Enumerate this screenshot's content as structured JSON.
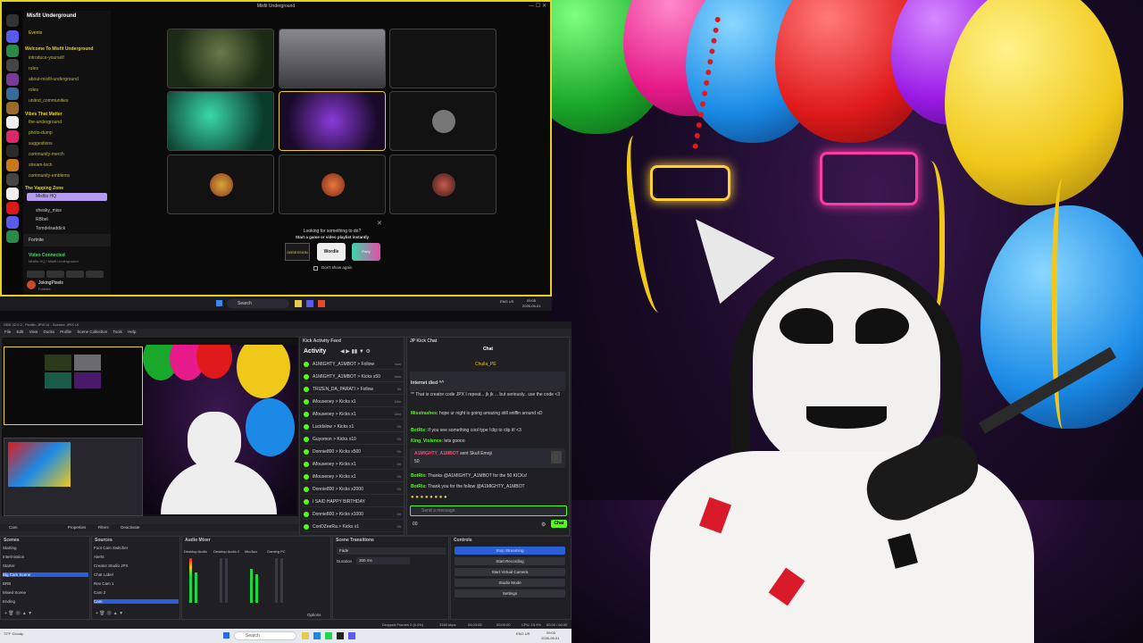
{
  "discord": {
    "window_title": "Misfit Underground",
    "server_name": "Misfit Underground",
    "events": "Events",
    "categories": [
      {
        "name": "Welcome To Misfit Underground",
        "channels": [
          "introduce-yourself",
          "rules",
          "about-misfit-underground",
          "roles",
          "unitod_communities"
        ]
      },
      {
        "name": "Vibes That Matter",
        "channels": [
          "the-underground",
          "photo-dump",
          "suggestions",
          "community-merch",
          "stream-tech",
          "community-emblems"
        ]
      },
      {
        "name": "The Vapping Zone",
        "channels": []
      }
    ],
    "voice_users": [
      "Misfits HQ",
      "sheaky_miss",
      "RBbel",
      "Tomdelsaddick"
    ],
    "game_activity": "Fortnite",
    "voice_status": "Video Connected",
    "voice_sub": "Misfits HQ / Misfit Underground",
    "user_name": "JokingPixels",
    "user_status": "Fortnite",
    "launcher_title": "Looking for something to do?",
    "launcher_sub": "Start a game or video playlist instantly",
    "launcher_games": [
      "OBSESSION",
      "Wordle",
      "Party"
    ],
    "dont_show": "Don't show again"
  },
  "taskbar_top": {
    "search_placeholder": "Search",
    "lang": "ENG US",
    "clock_time": "09:05",
    "clock_date": "2026-06-01"
  },
  "obs": {
    "window_title": "OBS 32.0.2 - Profile: JPIX UI - Scenes: JPIX UI",
    "menu": [
      "File",
      "Edit",
      "View",
      "Docks",
      "Profile",
      "Scene Collection",
      "Tools",
      "Help"
    ],
    "source_toolbar": [
      "Cam",
      "Properties",
      "Filters",
      "Deactivate"
    ],
    "scenes_title": "Scenes",
    "scenes": [
      "Starting",
      "Intermission",
      "Starter",
      "Big Cam Scene",
      "BRB",
      "Mixed Scene",
      "Ending"
    ],
    "selected_scene": "Big Cam Scene",
    "sources_title": "Sources",
    "sources": [
      "Foot Cam Switcher",
      "Alerts",
      "Creator Studio JPX",
      "Chat Label",
      "Rev Cam 1",
      "Cam 2",
      "Cam"
    ],
    "selected_source": "Cam",
    "mixer_title": "Audio Mixer",
    "mixer_channels": [
      "Desktop Audio",
      "Desktop Audio 2",
      "Mic/Aux",
      "Gaming PC"
    ],
    "transitions_title": "Scene Transitions",
    "transition": "Fade",
    "duration_label": "Duration",
    "duration_value": "300 ms",
    "controls_title": "Controls",
    "controls": [
      "Stop Streaming",
      "Start Recording",
      "Start Virtual Camera",
      "Studio Mode",
      "Settings"
    ],
    "active_control": "Stop Streaming",
    "status": {
      "dropped": "Dropped Frames 0 (0.0%)",
      "bitrate": "3169 kbps",
      "live": "04:03:05",
      "rec": "00:00:00",
      "cpu": "CPU: 15.9%",
      "fps": "60.00 / 60.00 FPS"
    },
    "mixer_options": "Options"
  },
  "kick_feed": {
    "title": "Kick Activity Feed",
    "tab": "Activity",
    "rows": [
      {
        "text": "A1MIGHTY_A1MBOT > Follow",
        "time": "now"
      },
      {
        "text": "A1MIGHTY_A1MBOT > Kicks x50",
        "time": "now"
      },
      {
        "text": "TRIZEN_DA_PARATI > Follow",
        "time": "5s"
      },
      {
        "text": "iMouseoey > Kicks x1",
        "time": "18m"
      },
      {
        "text": "iMouseoey > Kicks x1",
        "time": "18m"
      },
      {
        "text": "Lucidslow > Kicks x1",
        "time": "5h"
      },
      {
        "text": "Guyomon > Kicks x10",
        "time": "5h"
      },
      {
        "text": "Donnie800 > Kicks x500",
        "time": "5h"
      },
      {
        "text": "iMouseoey > Kicks x1",
        "time": "5h"
      },
      {
        "text": "iMouseoey > Kicks x1",
        "time": "5h"
      },
      {
        "text": "Donnie800 > Kicks x2000",
        "time": "5h"
      },
      {
        "text": "I SAID HAPPY BIRTHDAY",
        "time": ""
      },
      {
        "text": "Donnie800 > Kicks x1000",
        "time": "5h"
      },
      {
        "text": "ConDZeeRa > Kicks x1",
        "time": "5h"
      }
    ]
  },
  "kick_chat": {
    "title": "JP Kick Chat",
    "header": "Chat",
    "pinned_user": "Chulla_PE",
    "lines": [
      {
        "user": "",
        "text": "Internet died ^^"
      },
      {
        "user": "",
        "text": "** That is creator code JPX I repeat... jk jk ... but seriously.. use the code <3"
      },
      {
        "user": "Misstrashes:",
        "text": "hope ur night is going amazing still sniffin around xD"
      },
      {
        "user": "BotRix:",
        "text": "If you see something cool type !clip to clip it! <3"
      },
      {
        "user": "King_Violence:",
        "text": "lets goooo"
      }
    ],
    "gift_user": "A1MIGHTY_A1MBOT",
    "gift_text": "sent Skull Emoji",
    "gift_amount": "50",
    "bot_lines": [
      {
        "user": "BotRix:",
        "text": "Thanks @A1MIGHTY_A1MBOT for the 50 KICKs!"
      },
      {
        "user": "BotRix:",
        "text": "Thank you for the follow @A1MIGHTY_A1MBOT"
      }
    ],
    "input_placeholder": "Send a message",
    "points": "00",
    "send_label": "Chat"
  },
  "taskbar_bot": {
    "search_placeholder": "Search",
    "weather": "72°F Cloudy",
    "lang": "ENG US",
    "clock_time": "09:05",
    "clock_date": "2026-06-01"
  }
}
